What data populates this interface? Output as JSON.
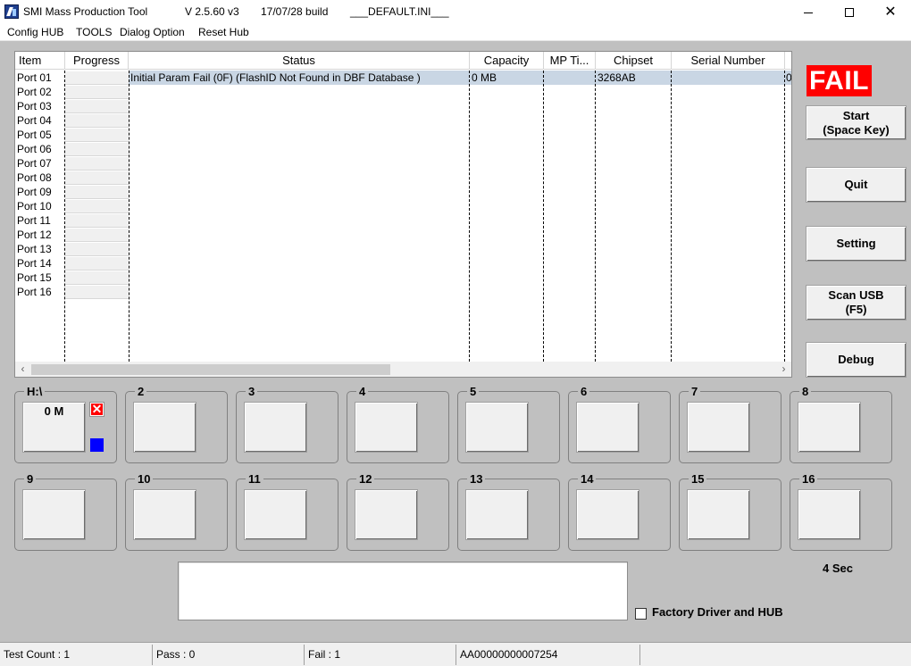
{
  "titlebar": {
    "app_name": "SMI Mass Production Tool",
    "version": "V 2.5.60   v3",
    "build": "17/07/28 build",
    "ini": "___DEFAULT.INI___",
    "minimize_icon": "minimize-icon",
    "maximize_icon": "maximize-icon",
    "close_icon": "close-icon"
  },
  "menu": [
    "Config HUB",
    "TOOLS",
    "Dialog Option",
    "Reset Hub"
  ],
  "list": {
    "columns": [
      "Item",
      "Progress",
      "Status",
      "Capacity",
      "MP Ti...",
      "Chipset",
      "Serial Number"
    ],
    "rows": [
      {
        "port": "Port 01",
        "status": "Initial Param Fail (0F) (FlashID Not Found in DBF Database )",
        "capacity": "0 MB",
        "mp_time": "",
        "chipset": "3268AB",
        "serial": "",
        "extra": "0",
        "selected": true
      },
      {
        "port": "Port 02"
      },
      {
        "port": "Port 03"
      },
      {
        "port": "Port 04"
      },
      {
        "port": "Port 05"
      },
      {
        "port": "Port 06"
      },
      {
        "port": "Port 07"
      },
      {
        "port": "Port 08"
      },
      {
        "port": "Port 09"
      },
      {
        "port": "Port 10"
      },
      {
        "port": "Port 11"
      },
      {
        "port": "Port 12"
      },
      {
        "port": "Port 13"
      },
      {
        "port": "Port 14"
      },
      {
        "port": "Port 15"
      },
      {
        "port": "Port 16"
      }
    ]
  },
  "result_badge": "FAIL",
  "colors": {
    "fail": "#ff0000",
    "background": "#c0c0c0",
    "selection": "#c9d6e4"
  },
  "buttons": {
    "start": [
      "Start",
      "(Space Key)"
    ],
    "quit": "Quit",
    "setting": "Setting",
    "scan_usb": [
      "Scan USB",
      "(F5)"
    ],
    "debug": "Debug"
  },
  "ports": [
    {
      "label": "H:\\",
      "value": "0 M",
      "fail_icon": "x-mark-icon",
      "status_icon": "blue-square-icon"
    },
    {
      "label": "2",
      "value": ""
    },
    {
      "label": "3",
      "value": ""
    },
    {
      "label": "4",
      "value": ""
    },
    {
      "label": "5",
      "value": ""
    },
    {
      "label": "6",
      "value": ""
    },
    {
      "label": "7",
      "value": ""
    },
    {
      "label": "8",
      "value": ""
    },
    {
      "label": "9",
      "value": ""
    },
    {
      "label": "10",
      "value": ""
    },
    {
      "label": "11",
      "value": ""
    },
    {
      "label": "12",
      "value": ""
    },
    {
      "label": "13",
      "value": ""
    },
    {
      "label": "14",
      "value": ""
    },
    {
      "label": "15",
      "value": ""
    },
    {
      "label": "16",
      "value": ""
    }
  ],
  "timer": "4 Sec",
  "factory_checkbox": {
    "label": "Factory Driver and HUB",
    "checked": false
  },
  "statusbar": {
    "test_count": "Test Count : 1",
    "pass": "Pass : 0",
    "fail": "Fail : 1",
    "serial": "AA00000000007254",
    "blank": ""
  }
}
